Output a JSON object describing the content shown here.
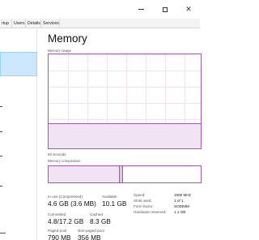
{
  "tabs": [
    "rtup",
    "Users",
    "Details",
    "Services"
  ],
  "memory": {
    "title": "Memory",
    "usage_label": "Memory usage",
    "time_label": "60 seconds",
    "composition_label": "Memory composition",
    "usage_fraction": 0.27,
    "composition": {
      "in_use_fraction": 0.47,
      "modified_fraction": 0.02,
      "standby_fraction": 0.5
    },
    "stats": {
      "in_use_label": "In use (Compressed)",
      "in_use_value": "4.6 GB (3.6 MB)",
      "available_label": "Available",
      "available_value": "10.1 GB",
      "committed_label": "Committed",
      "committed_value": "4.8/17.2 GB",
      "cached_label": "Cached",
      "cached_value": "8.3 GB",
      "paged_label": "Paged pool",
      "paged_value": "790 MB",
      "nonpaged_label": "Non-paged pool",
      "nonpaged_value": "356 MB"
    },
    "specs": {
      "speed_label": "Speed:",
      "speed_value": "1600 MHz",
      "slots_label": "Slots used:",
      "slots_value": "1 of 1",
      "form_label": "Form factor:",
      "form_value": "SODIMM",
      "reserved_label": "Hardware reserved:",
      "reserved_value": "1.1 GB"
    }
  },
  "colors": {
    "accent": "#9d5ba9",
    "accent_fill": "#f1e3f3",
    "selected": "#cce8ff"
  }
}
